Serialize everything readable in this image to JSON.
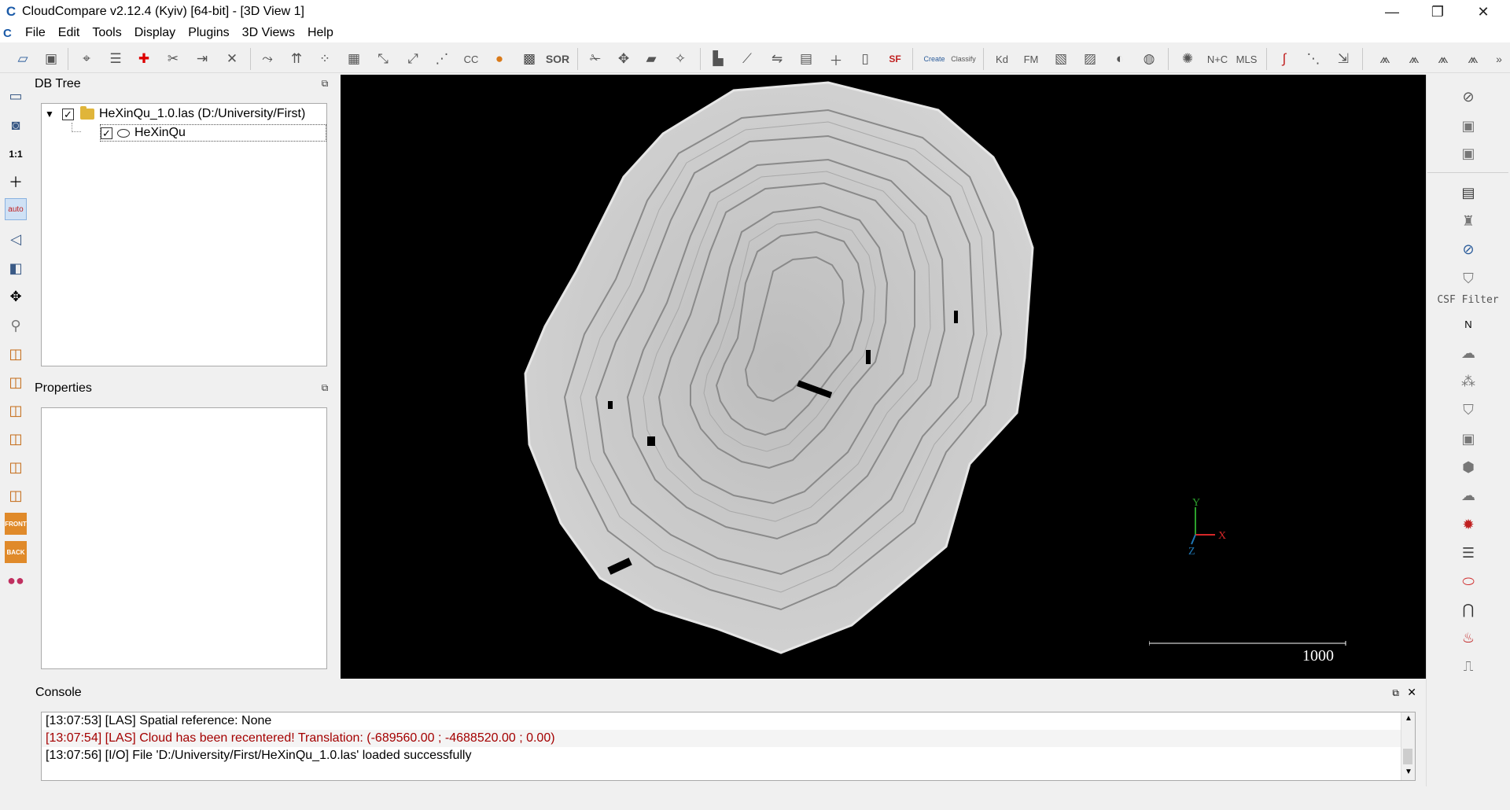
{
  "window": {
    "title": "CloudCompare v2.12.4 (Kyiv) [64-bit] - [3D View 1]",
    "logo_text": "C",
    "minimize_glyph": "—",
    "maximize_glyph": "❐",
    "close_glyph": "✕"
  },
  "menubar": {
    "logo_text": "C",
    "items": [
      "File",
      "Edit",
      "Tools",
      "Display",
      "Plugins",
      "3D Views",
      "Help"
    ]
  },
  "toolbar": {
    "labels": {
      "cc": "CC",
      "sor": "SOR",
      "sf": "SF",
      "canupo_create": "Create",
      "canupo_classify": "Classify",
      "kd": "Kd",
      "fm": "FM",
      "nc": "N+C",
      "mls": "MLS"
    }
  },
  "left_toolbar": {
    "scale_label": "1:1",
    "auto_label": "auto",
    "front_label": "FRONT",
    "back_label": "BACK"
  },
  "db_tree": {
    "title": "DB Tree",
    "items": [
      {
        "label": "HeXinQu_1.0.las (D:/University/First)",
        "checked": true,
        "expanded": true
      },
      {
        "label": "HeXinQu",
        "checked": true
      }
    ]
  },
  "properties": {
    "title": "Properties"
  },
  "view3d": {
    "scale_value": "1000",
    "axis_y": "Y",
    "axis_z": "Z",
    "axis_x": "X"
  },
  "right_toolbar": {
    "csf_label": "CSF Filter",
    "north_label": "N"
  },
  "console": {
    "title": "Console",
    "lines": [
      {
        "text": "[13:07:53] [LAS] Spatial reference: None",
        "level": "info"
      },
      {
        "text": "[13:07:54] [LAS] Cloud has been recentered! Translation: (-689560.00 ; -4688520.00 ; 0.00)",
        "level": "warning"
      },
      {
        "text": "[13:07:56] [I/O] File 'D:/University/First/HeXinQu_1.0.las' loaded successfully",
        "level": "info"
      }
    ]
  },
  "colors": {
    "accent": "#1a5aa8",
    "warning_text": "#a40000",
    "view_background": "#000000"
  }
}
